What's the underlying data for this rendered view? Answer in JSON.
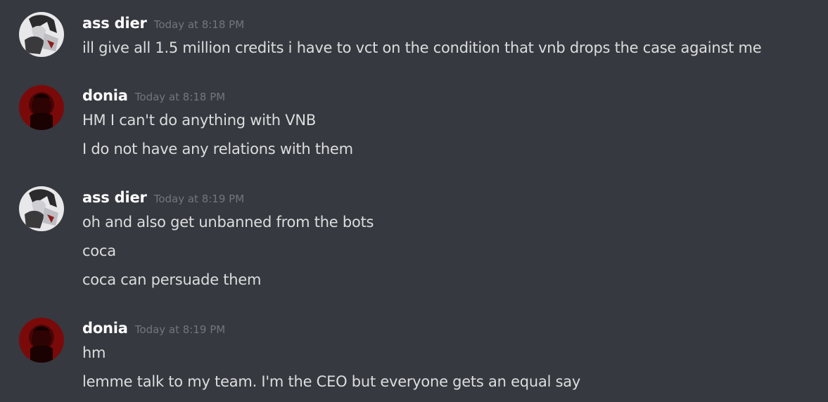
{
  "messages": [
    {
      "username": "ass dier",
      "timestamp": "Today at 8:18 PM",
      "avatar": "anime-character-avatar",
      "lines": [
        "ill give all 1.5 million credits i have to vct on the condition that vnb drops the case against me"
      ]
    },
    {
      "username": "donia",
      "timestamp": "Today at 8:18 PM",
      "avatar": "red-photo-avatar",
      "lines": [
        "HM I can't do anything with VNB",
        "I do not have any relations with them"
      ]
    },
    {
      "username": "ass dier",
      "timestamp": "Today at 8:19 PM",
      "avatar": "anime-character-avatar",
      "lines": [
        "oh and also get unbanned from the bots",
        "coca",
        "coca can persuade them"
      ]
    },
    {
      "username": "donia",
      "timestamp": "Today at 8:19 PM",
      "avatar": "red-photo-avatar",
      "lines": [
        "hm",
        "lemme talk to my team. I'm the CEO but everyone gets an equal say"
      ]
    }
  ],
  "colors": {
    "background": "#36393f",
    "username": "#ffffff",
    "timestamp": "#72767d",
    "message_text": "#dcddde"
  }
}
